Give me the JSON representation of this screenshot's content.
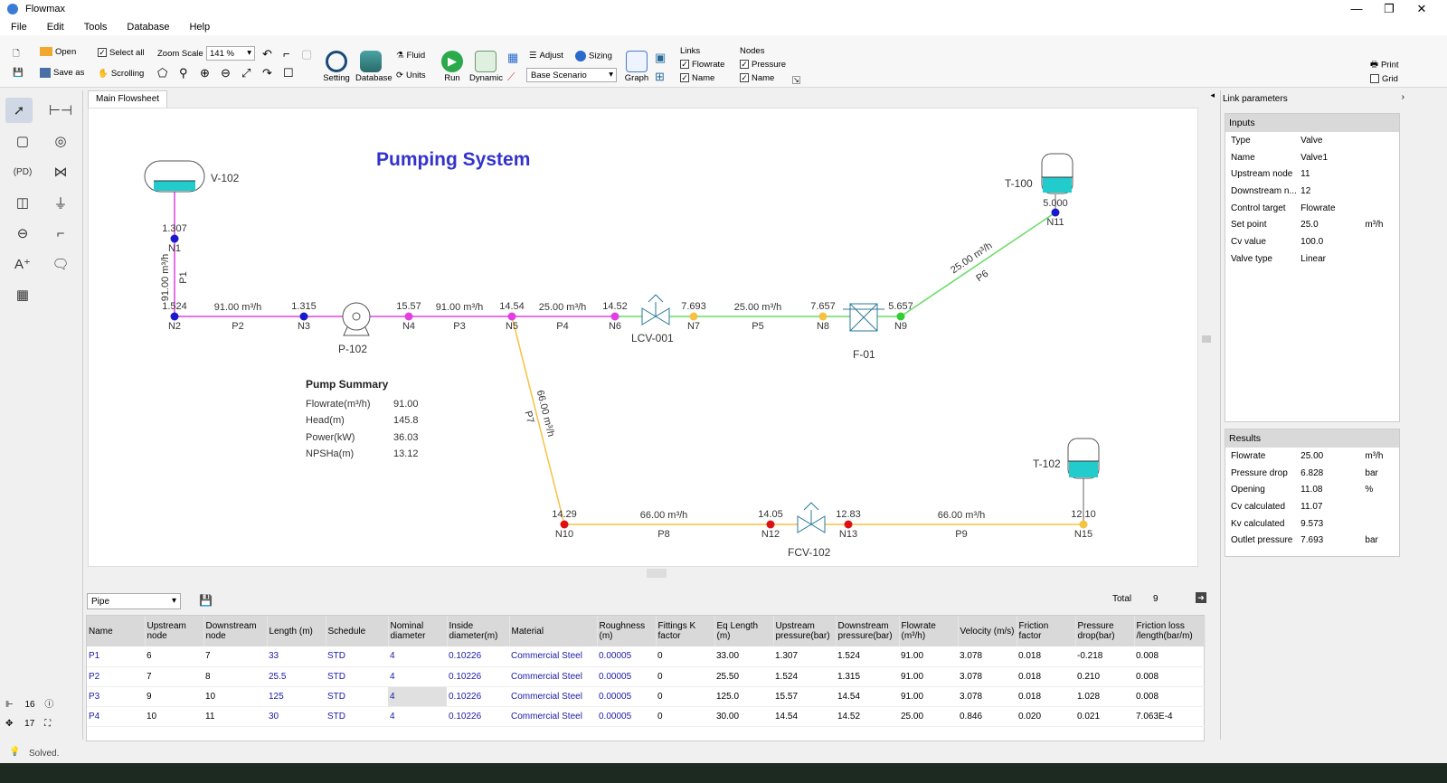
{
  "app": {
    "title": "Flowmax"
  },
  "window_controls": {
    "minimize": "—",
    "restore": "❐",
    "close": "✕"
  },
  "menu": [
    "File",
    "Edit",
    "Tools",
    "Database",
    "Help"
  ],
  "toolbar": {
    "open": "Open",
    "save_as": "Save as",
    "select_all": "Select all",
    "scrolling": "Scrolling",
    "zoom_scale_label": "Zoom Scale",
    "zoom_value": "141 %",
    "setting": "Setting",
    "database": "Database",
    "fluid": "Fluid",
    "units": "Units",
    "run": "Run",
    "dynamic": "Dynamic",
    "adjust": "Adjust",
    "sizing": "Sizing",
    "scenario": "Base Scenario",
    "graph": "Graph",
    "links_label": "Links",
    "links_flowrate": "Flowrate",
    "links_name": "Name",
    "nodes_label": "Nodes",
    "nodes_pressure": "Pressure",
    "nodes_name": "Name",
    "print": "Print",
    "grid": "Grid"
  },
  "tabs": {
    "main": "Main Flowsheet"
  },
  "flowsheet": {
    "title": "Pumping System",
    "equipment": {
      "v102": "V-102",
      "t100": "T-100",
      "t102": "T-102",
      "p102": "P-102",
      "lcv001": "LCV-001",
      "f01": "F-01",
      "fcv102": "FCV-102"
    },
    "nodes": {
      "N1": {
        "name": "N1",
        "pressure": "1.307"
      },
      "N2": {
        "name": "N2",
        "pressure": "1.524"
      },
      "N3": {
        "name": "N3",
        "pressure": "1.315"
      },
      "N4": {
        "name": "N4",
        "pressure": "15.57"
      },
      "N5": {
        "name": "N5",
        "pressure": "14.54"
      },
      "N6": {
        "name": "N6",
        "pressure": "14.52"
      },
      "N7": {
        "name": "N7",
        "pressure": "7.693"
      },
      "N8": {
        "name": "N8",
        "pressure": "7.657"
      },
      "N9": {
        "name": "N9",
        "pressure": "5.657"
      },
      "N10": {
        "name": "N10",
        "pressure": "14.29"
      },
      "N11": {
        "name": "N11",
        "pressure": "5.000"
      },
      "N12": {
        "name": "N12",
        "pressure": "14.05"
      },
      "N13": {
        "name": "N13",
        "pressure": "12.83"
      },
      "N15": {
        "name": "N15",
        "pressure": "12.10"
      }
    },
    "links": {
      "P1": {
        "name": "P1",
        "flow": "91.00 m³/h"
      },
      "P2": {
        "name": "P2",
        "flow": "91.00 m³/h"
      },
      "P3": {
        "name": "P3",
        "flow": "91.00 m³/h"
      },
      "P4": {
        "name": "P4",
        "flow": "25.00 m³/h"
      },
      "P5": {
        "name": "P5",
        "flow": "25.00 m³/h"
      },
      "P6": {
        "name": "P6",
        "flow": "25.00 m³/h"
      },
      "P7": {
        "name": "P7",
        "flow": "66.00 m³/h"
      },
      "P8": {
        "name": "P8",
        "flow": "66.00 m³/h"
      },
      "P9": {
        "name": "P9",
        "flow": "66.00 m³/h"
      }
    },
    "pump_summary": {
      "title": "Pump Summary",
      "rows": [
        {
          "label": "Flowrate(m³/h)",
          "value": "91.00"
        },
        {
          "label": "Head(m)",
          "value": "145.8"
        },
        {
          "label": "Power(kW)",
          "value": "36.03"
        },
        {
          "label": "NPSHa(m)",
          "value": "13.12"
        }
      ]
    }
  },
  "right_panel": {
    "title": "Link parameters",
    "inputs_header": "Inputs",
    "inputs": [
      {
        "k": "Type",
        "v": "Valve",
        "u": ""
      },
      {
        "k": "Name",
        "v": "Valve1",
        "u": ""
      },
      {
        "k": "Upstream node",
        "v": "11",
        "u": ""
      },
      {
        "k": "Downstream n...",
        "v": "12",
        "u": ""
      },
      {
        "k": "Control target",
        "v": "Flowrate",
        "u": ""
      },
      {
        "k": "Set point",
        "v": "25.0",
        "u": "m³/h"
      },
      {
        "k": "Cv value",
        "v": "100.0",
        "u": ""
      },
      {
        "k": "Valve type",
        "v": "Linear",
        "u": ""
      }
    ],
    "results_header": "Results",
    "results": [
      {
        "k": "Flowrate",
        "v": "25.00",
        "u": "m³/h"
      },
      {
        "k": "Pressure drop",
        "v": "6.828",
        "u": "bar"
      },
      {
        "k": "Opening",
        "v": "11.08",
        "u": "%"
      },
      {
        "k": "Cv calculated",
        "v": "11.07",
        "u": ""
      },
      {
        "k": "Kv calculated",
        "v": "9.573",
        "u": ""
      },
      {
        "k": "Outlet pressure",
        "v": "7.693",
        "u": "bar"
      }
    ]
  },
  "bottom": {
    "type_select": "Pipe",
    "total_label": "Total",
    "total_value": "9",
    "columns": [
      "Name",
      "Upstream node",
      "Downstream node",
      "Length (m)",
      "Schedule",
      "Nominal diameter",
      "Inside diameter(m)",
      "Material",
      "Roughness (m)",
      "Fittings K factor",
      "Eq Length (m)",
      "Upstream pressure(bar)",
      "Downstream pressure(bar)",
      "Flowrate (m³/h)",
      "Velocity (m/s)",
      "Friction factor",
      "Pressure drop(bar)",
      "Friction loss /length(bar/m)"
    ],
    "rows": [
      [
        "P1",
        "6",
        "7",
        "33",
        "STD",
        "4",
        "0.10226",
        "Commercial Steel",
        "0.00005",
        "0",
        "33.00",
        "1.307",
        "1.524",
        "91.00",
        "3.078",
        "0.018",
        "-0.218",
        "0.008"
      ],
      [
        "P2",
        "7",
        "8",
        "25.5",
        "STD",
        "4",
        "0.10226",
        "Commercial Steel",
        "0.00005",
        "0",
        "25.50",
        "1.524",
        "1.315",
        "91.00",
        "3.078",
        "0.018",
        "0.210",
        "0.008"
      ],
      [
        "P3",
        "9",
        "10",
        "125",
        "STD",
        "4",
        "0.10226",
        "Commercial Steel",
        "0.00005",
        "0",
        "125.0",
        "15.57",
        "14.54",
        "91.00",
        "3.078",
        "0.018",
        "1.028",
        "0.008"
      ],
      [
        "P4",
        "10",
        "11",
        "30",
        "STD",
        "4",
        "0.10226",
        "Commercial Steel",
        "0.00005",
        "0",
        "30.00",
        "14.54",
        "14.52",
        "25.00",
        "0.846",
        "0.020",
        "0.021",
        "7.063E-4"
      ]
    ]
  },
  "left_counts": {
    "pipes": "16",
    "nodes": "17"
  },
  "status": {
    "text": "Solved."
  },
  "colors": {
    "magenta_line": "#e040e0",
    "green_line": "#66dd66",
    "yellow_line": "#f5c242",
    "node_blue": "#1a1acc",
    "node_red": "#dd1111",
    "tank_fill": "#22cccc",
    "title_blue": "#3333cc"
  }
}
